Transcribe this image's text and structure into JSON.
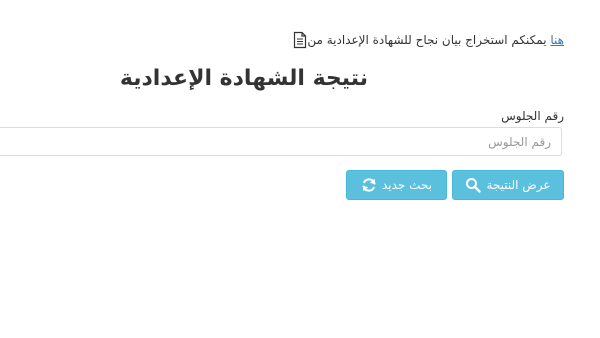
{
  "notice": {
    "text": "يمكنكم استخراج بيان نجاح للشهادة الإعدادية من",
    "link_text": "هنا"
  },
  "page": {
    "title": "نتيجة الشهادة الإعدادية"
  },
  "form": {
    "seat_label": "رقم الجلوس",
    "seat_placeholder": "رقم الجلوس",
    "seat_value": ""
  },
  "buttons": {
    "show_result": "عرض النتيجة",
    "new_search": "بحث جديد",
    "show_result_icon": "search-icon",
    "new_search_icon": "refresh-icon"
  },
  "colors": {
    "button_bg": "#5bc0de",
    "link": "#337ab7"
  }
}
